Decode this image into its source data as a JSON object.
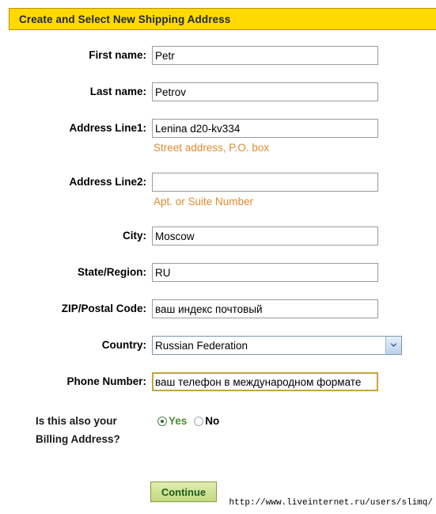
{
  "header": {
    "title": "Create and Select New Shipping Address",
    "background_color": "#ffd900",
    "text_color": "#1f2740"
  },
  "form": {
    "fields": [
      {
        "label": "First name:",
        "value": "Petr",
        "placeholder": "",
        "type": "text",
        "hint": "",
        "focused": false
      },
      {
        "label": "Last name:",
        "value": "Petrov",
        "placeholder": "",
        "type": "text",
        "hint": "",
        "focused": false
      },
      {
        "label": "Address Line1:",
        "value": "Lenina d20-kv334",
        "placeholder": "",
        "type": "text",
        "hint": "Street address, P.O. box",
        "focused": false
      },
      {
        "label": "Address Line2:",
        "value": "",
        "placeholder": "",
        "type": "text",
        "hint": "Apt. or Suite Number",
        "focused": false
      },
      {
        "label": "City:",
        "value": "Moscow",
        "placeholder": "",
        "type": "text",
        "hint": "",
        "focused": false
      },
      {
        "label": "State/Region:",
        "value": "RU",
        "placeholder": "",
        "type": "text",
        "hint": "",
        "focused": false
      },
      {
        "label": "ZIP/Postal Code:",
        "value": "ваш индекс почтовый",
        "placeholder": "",
        "type": "text",
        "hint": "",
        "focused": false
      },
      {
        "label": "Country:",
        "value": "Russian Federation",
        "placeholder": "",
        "type": "select",
        "hint": "",
        "focused": false
      },
      {
        "label": "Phone Number:",
        "value": "ваш телефон в международном формате",
        "placeholder": "",
        "type": "text",
        "hint": "",
        "focused": true
      }
    ],
    "country_options": [
      "Russian Federation"
    ],
    "hint_color": "#e08a2e"
  },
  "billing": {
    "question": "Is this also your Billing Address?",
    "options": [
      {
        "label": "Yes",
        "selected": true
      },
      {
        "label": "No",
        "selected": false
      }
    ],
    "selected_color": "#4f8a30"
  },
  "actions": {
    "continue_label": "Continue"
  },
  "watermark": {
    "url": "http://www.liveinternet.ru/users/slimq/"
  }
}
